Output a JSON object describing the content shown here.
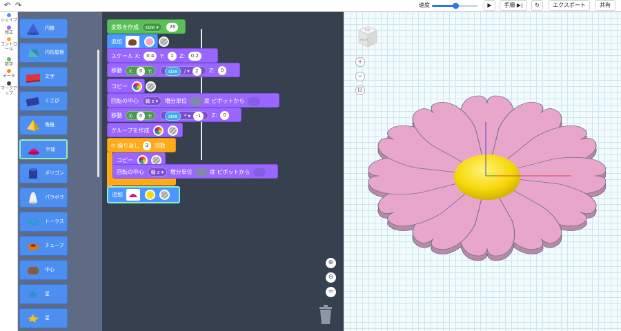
{
  "topbar": {
    "back_icon": "undo-arrow-icon",
    "forward_icon": "redo-arrow-icon",
    "speed_label": "速度",
    "speed_fraction": 0.52,
    "play_icon": "play-icon",
    "step_label": "手順",
    "step_icon": "step-forward-icon",
    "reset_icon": "refresh-icon",
    "export_label": "エクスポート",
    "share_label": "共有"
  },
  "categories": [
    {
      "label": "シェイプ",
      "color": "#4c97ff"
    },
    {
      "label": "修正",
      "color": "#9966ff"
    },
    {
      "label": "コントロール",
      "color": "#ffab19"
    },
    {
      "label": "数学",
      "color": "#59c059"
    },
    {
      "label": "データ",
      "color": "#ff8c1a"
    },
    {
      "label": "マークアップ",
      "color": "#37404f"
    }
  ],
  "palette": [
    {
      "label": "円錐",
      "icon": "cone-icon"
    },
    {
      "label": "円形屋根",
      "icon": "round-roof-icon"
    },
    {
      "label": "文字",
      "icon": "text-3d-icon"
    },
    {
      "label": "くさび",
      "icon": "wedge-icon"
    },
    {
      "label": "角錐",
      "icon": "pyramid-icon"
    },
    {
      "label": "半球",
      "icon": "half-sphere-icon",
      "selected": true
    },
    {
      "label": "ポリゴン",
      "icon": "polygon-icon"
    },
    {
      "label": "パラボラ",
      "icon": "paraboloid-icon"
    },
    {
      "label": "トーラス",
      "icon": "torus-icon"
    },
    {
      "label": "チューブ",
      "icon": "tube-icon"
    },
    {
      "label": "中心",
      "icon": "center-icon"
    },
    {
      "label": "星",
      "icon": "star-icon"
    },
    {
      "label": "星",
      "icon": "star-icon"
    }
  ],
  "blocks": {
    "create_var": {
      "label": "変数を作成",
      "var": "size",
      "value": "26"
    },
    "add1": {
      "label": "追加",
      "color": "#f2a9cc"
    },
    "scale": {
      "label": "スケール",
      "x_label": "X:",
      "x": "0.4",
      "y_label": "Y:",
      "y": "1",
      "z_label": "Z:",
      "z": "0.2"
    },
    "move1": {
      "label": "移動",
      "x_label": "X:",
      "x": "0",
      "y_label": "Y:",
      "y_var": "size",
      "op": "/",
      "y_num": "2",
      "z_label": "Z:",
      "z": "0"
    },
    "copy1": {
      "label": "コピー"
    },
    "rotate1": {
      "label": "回転の中心",
      "axis": "軸 z",
      "inc_label": "増分単位",
      "unit": "度",
      "pivot": "ピボットから"
    },
    "move2": {
      "label": "移動",
      "x_label": "X:",
      "x": "0",
      "y_label": "Y:",
      "y_var": "size",
      "op": "*",
      "y_num": "-1",
      "z_label": "Z:",
      "z": "0"
    },
    "group": {
      "label": "グループを作成"
    },
    "repeat": {
      "label": "繰り返し",
      "count": "3",
      "times": "回数"
    },
    "copy2": {
      "label": "コピー"
    },
    "rotate2": {
      "label": "回転の中心",
      "axis": "軸 z",
      "inc_label": "増分単位",
      "unit": "度",
      "pivot": "ピボットから"
    },
    "add2": {
      "label": "追加",
      "color": "#f5d90a"
    }
  },
  "workspace": {
    "zoom_in_icon": "zoom-in-icon",
    "zoom_out_icon": "zoom-out-icon",
    "zoom_reset_icon": "zoom-reset-icon",
    "trash_icon": "trash-icon"
  },
  "viewport": {
    "cube_top": "TOP",
    "cube_front": "FRONT",
    "zoom_in": "+",
    "zoom_out": "−",
    "fit_icon": "fit-view-icon",
    "petal_color": "#e8a6cb",
    "center_color": "#f5d90a"
  }
}
